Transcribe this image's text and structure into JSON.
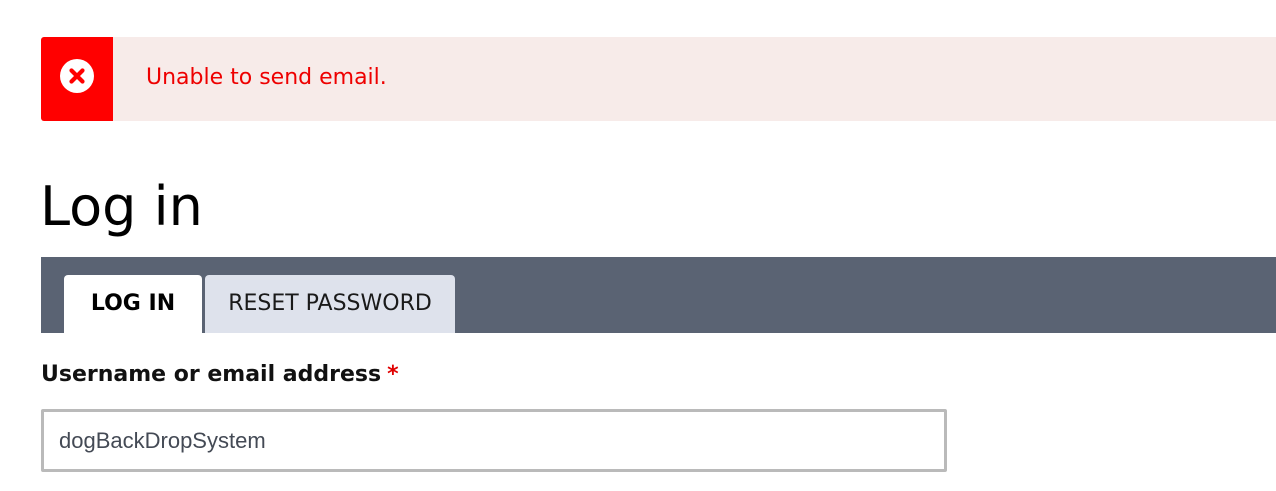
{
  "message": {
    "type": "error",
    "icon": "error-x-circle-icon",
    "text": "Unable to send email.",
    "accent_color": "#ff0000",
    "background_color": "#f7ebe9",
    "text_color": "#ee0000"
  },
  "page": {
    "title": "Log in"
  },
  "tabs": [
    {
      "label": "LOG IN",
      "active": true
    },
    {
      "label": "RESET PASSWORD",
      "active": false
    }
  ],
  "tabs_bar_color": "#5a6373",
  "form": {
    "username": {
      "label": "Username or email address",
      "required_mark": "*",
      "value": "dogBackDropSystem"
    }
  }
}
